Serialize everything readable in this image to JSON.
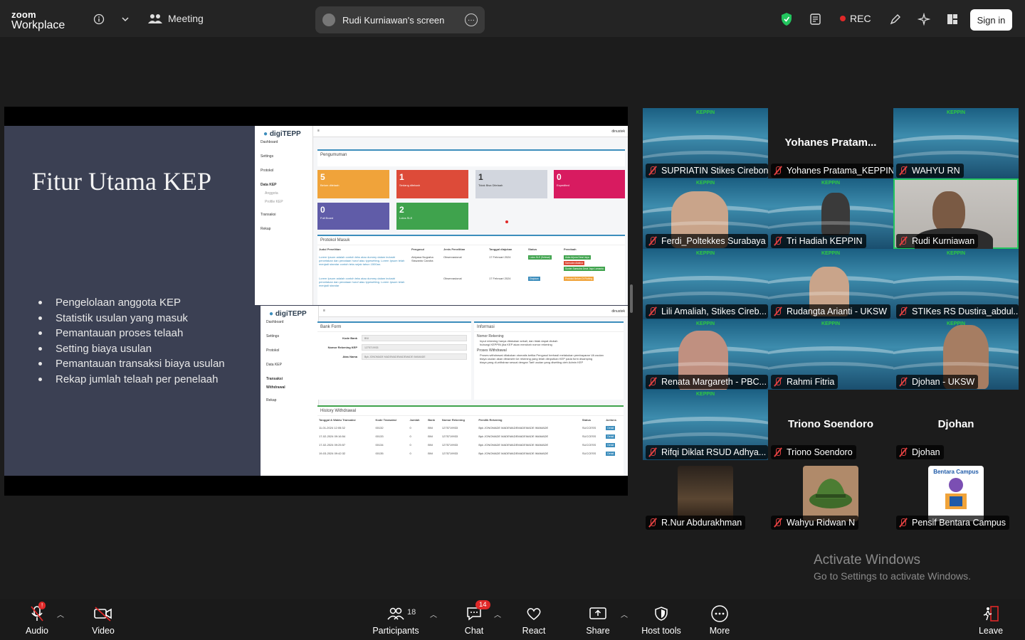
{
  "topbar": {
    "logo_line1": "zoom",
    "logo_line2": "Workplace",
    "meeting_label": "Meeting",
    "screen_label": "Rudi Kurniawan's screen",
    "rec_label": "REC",
    "signin_label": "Sign in"
  },
  "slide": {
    "title": "Fitur Utama KEP",
    "bullets": [
      "Pengelolaan anggota KEP",
      "Statistik usulan yang masuk",
      "Pemantauan proses telaah",
      "Setting biaya usulan",
      "Pemantauan transaksi biaya usulan",
      "Rekap jumlah telaah per penelaah"
    ]
  },
  "app1": {
    "brand": "digiTEPP",
    "nav": [
      "Dashboard",
      "Settings",
      "Protokol",
      "Data KEP",
      "Anggota",
      "Profile KEP",
      "Transaksi",
      "Rekap"
    ],
    "user": "dinustek",
    "announcement": "Pengumuman",
    "stats": [
      {
        "n": "5",
        "t": "Belum ditelaah",
        "color": "#f0a33a"
      },
      {
        "n": "1",
        "t": "Sedang ditelaah",
        "color": "#dd4b39"
      },
      {
        "n": "1",
        "t": "Tidak Bisa Ditelaah",
        "color": "#d2d6de"
      },
      {
        "n": "0",
        "t": "Expedited",
        "color": "#d81b60"
      },
      {
        "n": "0",
        "t": "Full Board",
        "color": "#605ca8"
      },
      {
        "n": "2",
        "t": "Lolos SLE",
        "color": "#3fa34d"
      }
    ],
    "protokol_title": "Protokol Masuk",
    "cols": [
      "Judul Penelitian",
      "Pengusul",
      "Jenis Penelitian",
      "Tanggal diajukan",
      "Status",
      "Penelaah"
    ],
    "rows": [
      {
        "judul": "Lorem Ipsum adalah contoh teks atau dummy dalam industri percetakan dan penataan huruf atau typesetting. Lorem Ipsum telah menjadi standar contoh teks sejak tahun 1500an.",
        "pengusul": "Abiyasa Nugraha Siswanto Candra",
        "jenis": "Observasional",
        "tanggal": "17 Februari 2024",
        "status": "Lolos SLE (Selesai)",
        "penelaah": [
          "Aska Arjuna Dewi Jaya",
          "Samudra Alakina",
          "Sunter Samudra Dewi Jaya Lamanta"
        ]
      },
      {
        "judul": "Lorem Ipsum adalah contoh teks atau dummy dalam industri percetakan dan penataan huruf atau typesetting. Lorem Ipsum telah menjadi standar",
        "pengusul": "",
        "jenis": "Observasional",
        "tanggal": "17 Februari 2024",
        "status": "Diajukan",
        "penelaah": [
          "Protokol Belum Di Plotting"
        ]
      }
    ]
  },
  "app2": {
    "brand": "digiTEPP",
    "nav": [
      "Dashboard",
      "Settings",
      "Protokol",
      "Data KEP",
      "Transaksi",
      "Withdrawal",
      "Rekap"
    ],
    "user": "dinustek",
    "bank_form": "Bank Form",
    "fields": [
      {
        "label": "Kode Bank",
        "value": "BNI"
      },
      {
        "label": "Nomor Rekening KEP",
        "value": "1275719933"
      },
      {
        "label": "Atas Nama",
        "value": "Bpk JONOMADE MADEMADEMADEMADE IMAMADE"
      }
    ],
    "info_title": "Informasi",
    "info_h1": "Nomor Rekening",
    "info_list1": [
      "Input rekening hanya dilakukan sekali, dan tidak dapat diubah",
      "hubungi KEPPIN jika KEP akan merubah nomor rekening"
    ],
    "info_h2": "Proses Withdrawal",
    "info_list2": [
      "Proses withdrawal dilakukan otomatis ketika Pengusul berhasil melakukan pembayaran VA usulan",
      "biaya usulan akan ditransfer ke rekening yang telah diinputkan KEP pada form disamping",
      "biaya yang di-withdraw sesuai dengan Tarif usulan yang disetting oleh Admin KEP"
    ],
    "history_title": "History Withdrawal",
    "hcols": [
      "Tanggal & Waktu Transaksi",
      "Kode Transaksi",
      "Jumlah",
      "Bank",
      "Nomor Rekening",
      "Pemilik Rekening",
      "Status",
      "Actions"
    ],
    "hrows": [
      [
        "11-01-2024 12:05:32",
        "00132",
        "0",
        "BNI",
        "1275719933",
        "Bpk JONOMADE MADEMADEMADEMADE IMAMADE",
        "SUCCESS",
        "Detail"
      ],
      [
        "17-02-2024 09:16:54",
        "00133",
        "0",
        "BNI",
        "1275719933",
        "Bpk JONOMADE MADEMADEMADEMADE IMAMADE",
        "SUCCESS",
        "Detail"
      ],
      [
        "17-02-2024 09:25:57",
        "00134",
        "0",
        "BNI",
        "1275719933",
        "Bpk JONOMADE MADEMADEMADEMADE IMAMADE",
        "SUCCESS",
        "Detail"
      ],
      [
        "19-03-2024 09:42:32",
        "00135",
        "0",
        "BNI",
        "1275719933",
        "Bpk JONOMADE MADEMADEMADEMADE IMAMADE",
        "SUCCESS",
        "Detail"
      ]
    ]
  },
  "participants_grid": [
    {
      "label": "SUPRIATIN Stikes Cirebon",
      "big": "",
      "bg": "keppin"
    },
    {
      "label": "Yohanes Pratama_KEPPIN",
      "big": "Yohanes  Pratam...",
      "bg": "dark"
    },
    {
      "label": "WAHYU RN",
      "big": "",
      "bg": "keppin"
    },
    {
      "label": "Ferdi_Poltekkes Surabaya",
      "big": "",
      "bg": "keppin"
    },
    {
      "label": "Tri Hadiah KEPPIN",
      "big": "",
      "bg": "keppin"
    },
    {
      "label": "Rudi Kurniawan",
      "big": "",
      "bg": "video"
    },
    {
      "label": "Lili Amaliah, Stikes Cireb...",
      "big": "",
      "bg": "keppin"
    },
    {
      "label": "Rudangta Arianti - UKSW",
      "big": "",
      "bg": "keppin"
    },
    {
      "label": "STIKes RS Dustira_abdul...",
      "big": "",
      "bg": "keppin"
    },
    {
      "label": "Renata Margareth - PBC...",
      "big": "",
      "bg": "keppin"
    },
    {
      "label": "Rahmi Fitria",
      "big": "",
      "bg": "keppin"
    },
    {
      "label": "Djohan - UKSW",
      "big": "",
      "bg": "keppin"
    },
    {
      "label": "Rifqi Diklat RSUD Adhya...",
      "big": "",
      "bg": "keppin"
    },
    {
      "label": "Triono Soendoro",
      "big": "Triono Soendoro",
      "bg": "dark"
    },
    {
      "label": "Djohan",
      "big": "Djohan",
      "bg": "dark"
    },
    {
      "label": "R.Nur Abdurakhman",
      "big": "",
      "bg": "dark"
    },
    {
      "label": "Wahyu Ridwan N",
      "big": "",
      "bg": "dark"
    },
    {
      "label": "Pensif Bentara Campus",
      "big": "",
      "bg": "dark"
    }
  ],
  "keppin_tile_text": "KEPPIN",
  "bentara_logo_text": "Bentara Campus",
  "watermark": {
    "line1": "Activate Windows",
    "line2": "Go to Settings to activate Windows."
  },
  "bottom": {
    "audio": "Audio",
    "video": "Video",
    "participants": "Participants",
    "participants_count": "18",
    "chat": "Chat",
    "chat_badge": "14",
    "react": "React",
    "share": "Share",
    "host_tools": "Host tools",
    "more": "More",
    "leave": "Leave"
  },
  "colors": {
    "accent_green": "#22c55e",
    "rec_red": "#e02828",
    "bar": "#1a1a1a"
  }
}
